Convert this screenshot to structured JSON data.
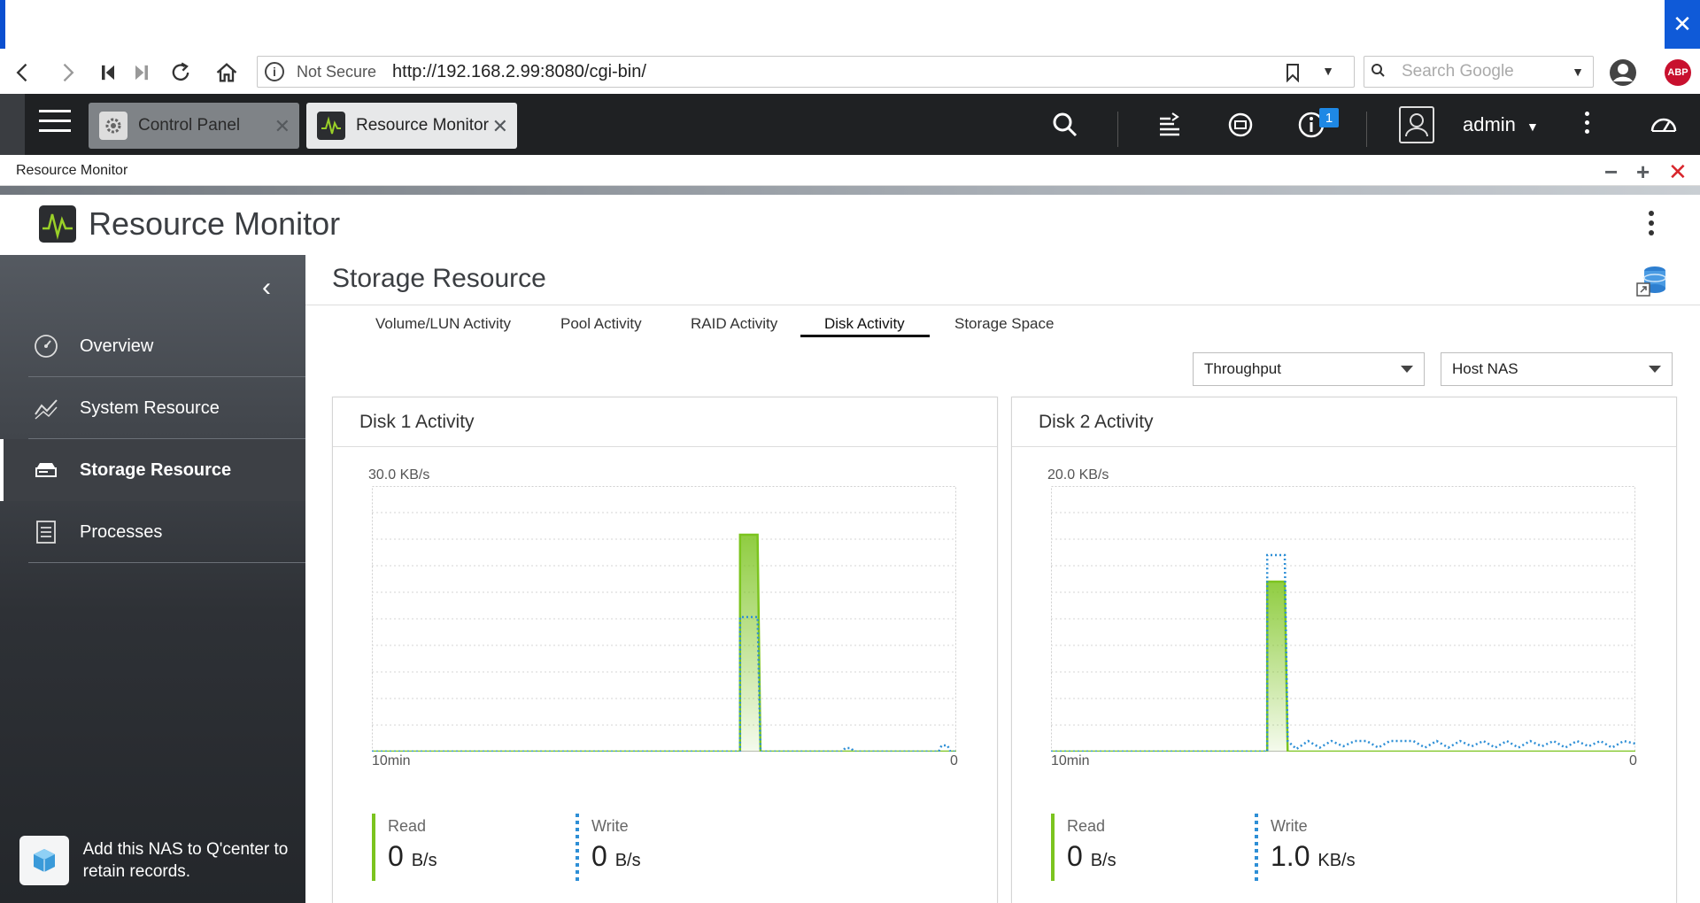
{
  "browser": {
    "not_secure": "Not Secure",
    "url": "http://192.168.2.99:8080/cgi-bin/",
    "search_placeholder": "Search Google",
    "abp": "ABP"
  },
  "nas_bar": {
    "tabs": [
      {
        "label": "Control Panel"
      },
      {
        "label": "Resource Monitor"
      }
    ],
    "notification_count": "1",
    "user": "admin"
  },
  "window": {
    "title": "Resource Monitor",
    "app_title": "Resource Monitor"
  },
  "sidebar": {
    "items": [
      {
        "label": "Overview",
        "icon": "gauge-icon"
      },
      {
        "label": "System Resource",
        "icon": "line-chart-icon"
      },
      {
        "label": "Storage Resource",
        "icon": "storage-icon"
      },
      {
        "label": "Processes",
        "icon": "list-icon"
      }
    ],
    "qcenter_text": "Add this NAS to Q'center to retain records."
  },
  "main": {
    "section_title": "Storage Resource",
    "tabs": [
      {
        "label": "Volume/LUN Activity"
      },
      {
        "label": "Pool Activity"
      },
      {
        "label": "RAID Activity"
      },
      {
        "label": "Disk Activity"
      },
      {
        "label": "Storage Space"
      }
    ],
    "active_tab": "Disk Activity",
    "metric_select": "Throughput",
    "host_select": "Host NAS"
  },
  "panels": [
    {
      "title": "Disk 1 Activity",
      "ymax_label": "30.0 KB/s",
      "x_start": "10min",
      "x_end": "0",
      "read_label": "Read",
      "read_value": "0",
      "read_unit": "B/s",
      "write_label": "Write",
      "write_value": "0",
      "write_unit": "B/s"
    },
    {
      "title": "Disk 2 Activity",
      "ymax_label": "20.0 KB/s",
      "x_start": "10min",
      "x_end": "0",
      "read_label": "Read",
      "read_value": "0",
      "read_unit": "B/s",
      "write_label": "Write",
      "write_value": "1.0",
      "write_unit": "KB/s"
    }
  ],
  "chart_data": [
    {
      "type": "area",
      "ylim": [
        0,
        30
      ],
      "y_unit": "KB/s",
      "x_unit": "minutes ago",
      "xlim": [
        10,
        0
      ],
      "series": [
        {
          "name": "Read",
          "color": "#7cc41f",
          "points": [
            [
              10,
              0
            ],
            [
              3.7,
              0
            ],
            [
              3.7,
              24.5
            ],
            [
              3.4,
              24.5
            ],
            [
              3.35,
              0
            ],
            [
              0,
              0
            ]
          ]
        },
        {
          "name": "Write",
          "color": "#2e8fd6",
          "points": [
            [
              10,
              0
            ],
            [
              3.7,
              0
            ],
            [
              3.7,
              15.2
            ],
            [
              3.4,
              15.2
            ],
            [
              3.35,
              0
            ],
            [
              1.95,
              0
            ],
            [
              1.9,
              0.4
            ],
            [
              1.8,
              0.4
            ],
            [
              1.75,
              0
            ],
            [
              0.3,
              0
            ],
            [
              0.25,
              0.7
            ],
            [
              0.15,
              0.7
            ],
            [
              0.1,
              0
            ],
            [
              0,
              0
            ]
          ]
        }
      ]
    },
    {
      "type": "area",
      "ylim": [
        0,
        20
      ],
      "y_unit": "KB/s",
      "x_unit": "minutes ago",
      "xlim": [
        10,
        0
      ],
      "series": [
        {
          "name": "Read",
          "color": "#7cc41f",
          "points": [
            [
              10,
              0
            ],
            [
              6.3,
              0
            ],
            [
              6.3,
              12.8
            ],
            [
              6.0,
              12.8
            ],
            [
              5.95,
              0
            ],
            [
              0,
              0
            ]
          ]
        },
        {
          "name": "Write",
          "color": "#2e8fd6",
          "points": [
            [
              10,
              0
            ],
            [
              6.3,
              0
            ],
            [
              6.3,
              14.8
            ],
            [
              6.0,
              14.8
            ],
            [
              5.95,
              0.8
            ],
            [
              5.8,
              0.2
            ],
            [
              5.6,
              0.8
            ],
            [
              5.4,
              0.3
            ],
            [
              5.2,
              0.8
            ],
            [
              5.0,
              0.4
            ],
            [
              4.8,
              0.8
            ],
            [
              4.6,
              0.8
            ],
            [
              4.4,
              0.3
            ],
            [
              4.2,
              0.8
            ],
            [
              4.0,
              0.8
            ],
            [
              3.8,
              0.8
            ],
            [
              3.6,
              0.3
            ],
            [
              3.4,
              0.8
            ],
            [
              3.2,
              0.3
            ],
            [
              3.0,
              0.8
            ],
            [
              2.8,
              0.4
            ],
            [
              2.6,
              0.8
            ],
            [
              2.4,
              0.3
            ],
            [
              2.2,
              0.8
            ],
            [
              2.0,
              0.3
            ],
            [
              1.8,
              0.8
            ],
            [
              1.6,
              0.4
            ],
            [
              1.4,
              0.8
            ],
            [
              1.2,
              0.3
            ],
            [
              1.0,
              0.8
            ],
            [
              0.8,
              0.4
            ],
            [
              0.6,
              0.8
            ],
            [
              0.4,
              0.3
            ],
            [
              0.2,
              0.8
            ],
            [
              0,
              0.6
            ]
          ]
        }
      ]
    }
  ]
}
